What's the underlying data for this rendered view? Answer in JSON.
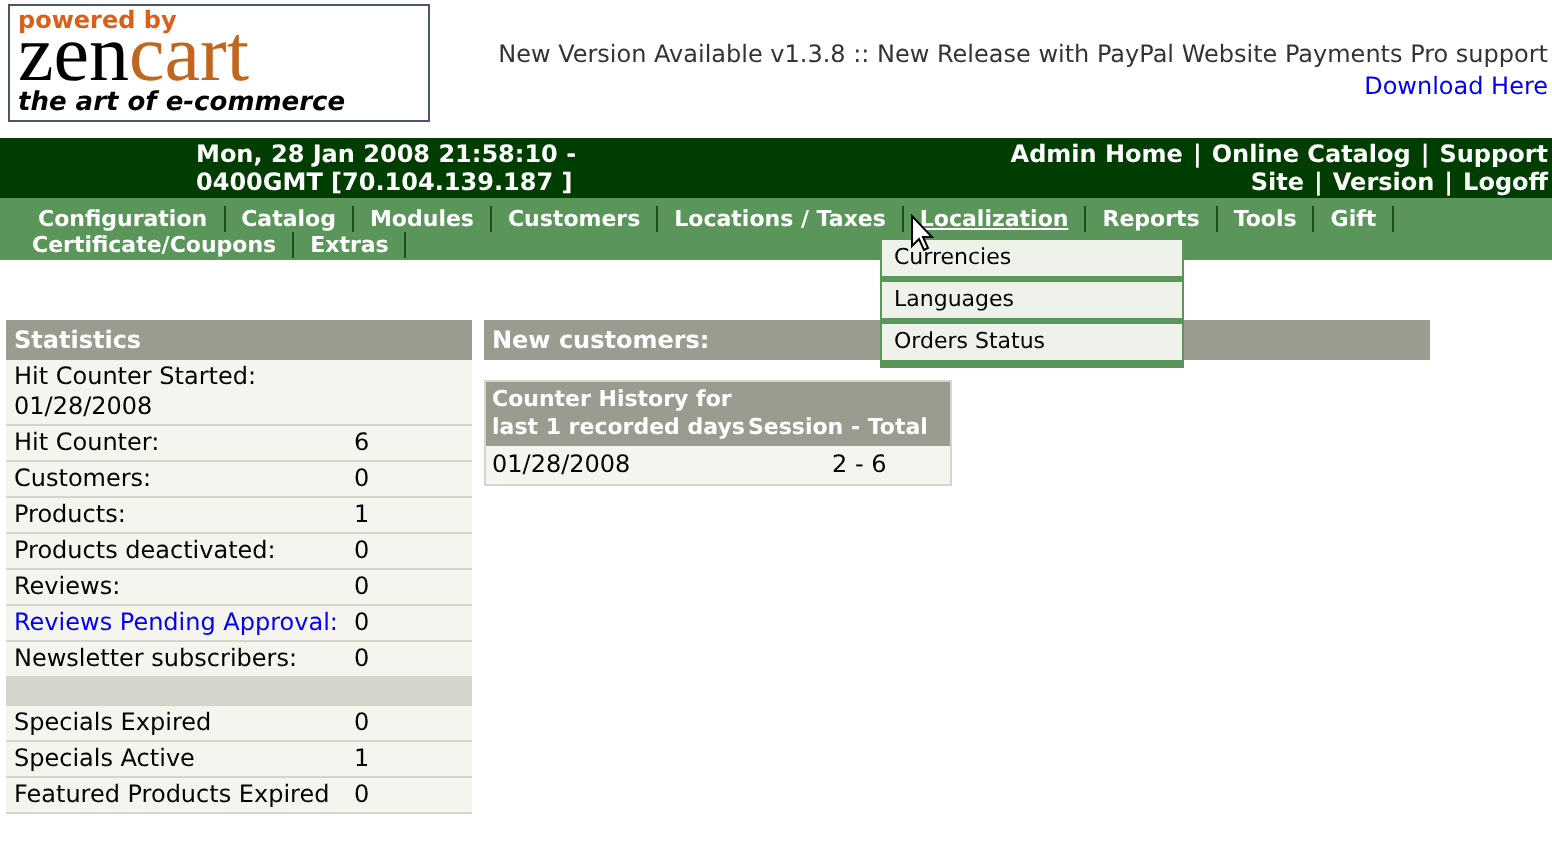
{
  "logo": {
    "tagline_top": "powered by",
    "brand_left": "zen",
    "brand_right": "cart",
    "tagline_bottom": "the art of e-commerce"
  },
  "version_notice": {
    "message": "New Version Available v1.3.8 :: New Release with PayPal Website Payments Pro support",
    "link": "Download Here"
  },
  "header_bar": {
    "datetime": "Mon, 28 Jan 2008 21:58:10 -",
    "timezone_ip": "0400GMT [70.104.139.187 ]",
    "links_row_1": [
      "Admin Home",
      "Online Catalog",
      "Support"
    ],
    "links_row_2": [
      "Site",
      "Version",
      "Logoff"
    ],
    "separator": "|"
  },
  "menu_rows": [
    [
      {
        "label": "Configuration",
        "selected": false
      },
      {
        "label": "Catalog",
        "selected": false
      },
      {
        "label": "Modules",
        "selected": false
      },
      {
        "label": "Customers",
        "selected": false
      },
      {
        "label": "Locations / Taxes",
        "selected": false
      },
      {
        "label": "Localization",
        "selected": true
      },
      {
        "label": "Reports",
        "selected": false
      },
      {
        "label": "Tools",
        "selected": false
      },
      {
        "label": "Gift",
        "selected": false
      }
    ],
    [
      {
        "label": "Certificate/Coupons",
        "selected": false
      },
      {
        "label": "Extras",
        "selected": false
      }
    ]
  ],
  "dropdown": {
    "items": [
      "Currencies",
      "Languages",
      "Orders Status"
    ]
  },
  "statistics": {
    "title": "Statistics",
    "rows": [
      {
        "kind": "text",
        "label": "Hit Counter Started: 01/28/2008"
      },
      {
        "kind": "text",
        "label": "Hit Counter:",
        "value": "6"
      },
      {
        "kind": "text",
        "label": "Customers:",
        "value": "0"
      },
      {
        "kind": "text",
        "label": "Products:",
        "value": "1"
      },
      {
        "kind": "text",
        "label": "Products deactivated:",
        "value": "0"
      },
      {
        "kind": "text",
        "label": "Reviews:",
        "value": "0"
      },
      {
        "kind": "link",
        "label": "Reviews Pending Approval:",
        "value": "0"
      },
      {
        "kind": "text",
        "label": "Newsletter subscribers:",
        "value": "0"
      },
      {
        "kind": "separator"
      },
      {
        "kind": "text",
        "label": "Specials Expired",
        "value": "0"
      },
      {
        "kind": "text",
        "label": "Specials Active",
        "value": "1"
      },
      {
        "kind": "text",
        "label": "Featured Products Expired",
        "value": "0"
      }
    ]
  },
  "new_customers": {
    "title": "New customers:"
  },
  "counter_history": {
    "title": "Counter History for last 1 recorded days",
    "column_2": "Session - Total",
    "rows": [
      {
        "date": "01/28/2008",
        "session_total": "2 - 6"
      }
    ]
  }
}
